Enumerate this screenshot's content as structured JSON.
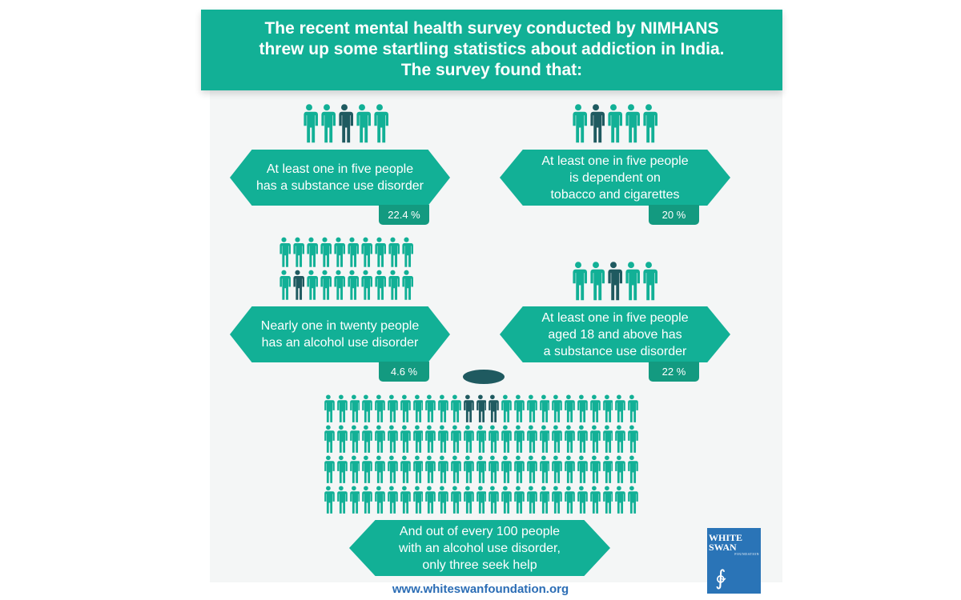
{
  "header": {
    "lines": [
      "The recent mental health survey conducted by NIMHANS",
      "threw up some startling statistics about addiction in India.",
      "The survey found that:"
    ]
  },
  "stats": [
    {
      "lines": [
        "At least one in five people",
        "has a substance use disorder"
      ],
      "percent": "22.4 %",
      "total": 5,
      "highlighted": [
        2
      ]
    },
    {
      "lines": [
        "At least one in five people",
        "is dependent on",
        "tobacco and cigarettes"
      ],
      "percent": "20 %",
      "total": 5,
      "highlighted": [
        1
      ]
    },
    {
      "lines": [
        "Nearly one in twenty people",
        "has an alcohol use disorder"
      ],
      "percent": "4.6 %",
      "total": 20,
      "highlighted": [
        11
      ]
    },
    {
      "lines": [
        "At least one in five people",
        "aged 18 and above has",
        "a substance use disorder"
      ],
      "percent": "22 %",
      "total": 5,
      "highlighted": [
        2
      ]
    }
  ],
  "help": {
    "lines": [
      "And out of every 100 people",
      "with an alcohol use disorder,",
      "only three seek help"
    ],
    "total": 100,
    "highlighted": [
      11,
      12,
      13
    ]
  },
  "logo": {
    "line1": "WHITE",
    "line2": "SWAN",
    "line3": "FOUNDATION"
  },
  "footer": {
    "url": "www.whiteswanfoundation.org"
  },
  "colors": {
    "teal": "#12b096",
    "dark": "#1f5a60",
    "blue": "#2a74b7"
  }
}
